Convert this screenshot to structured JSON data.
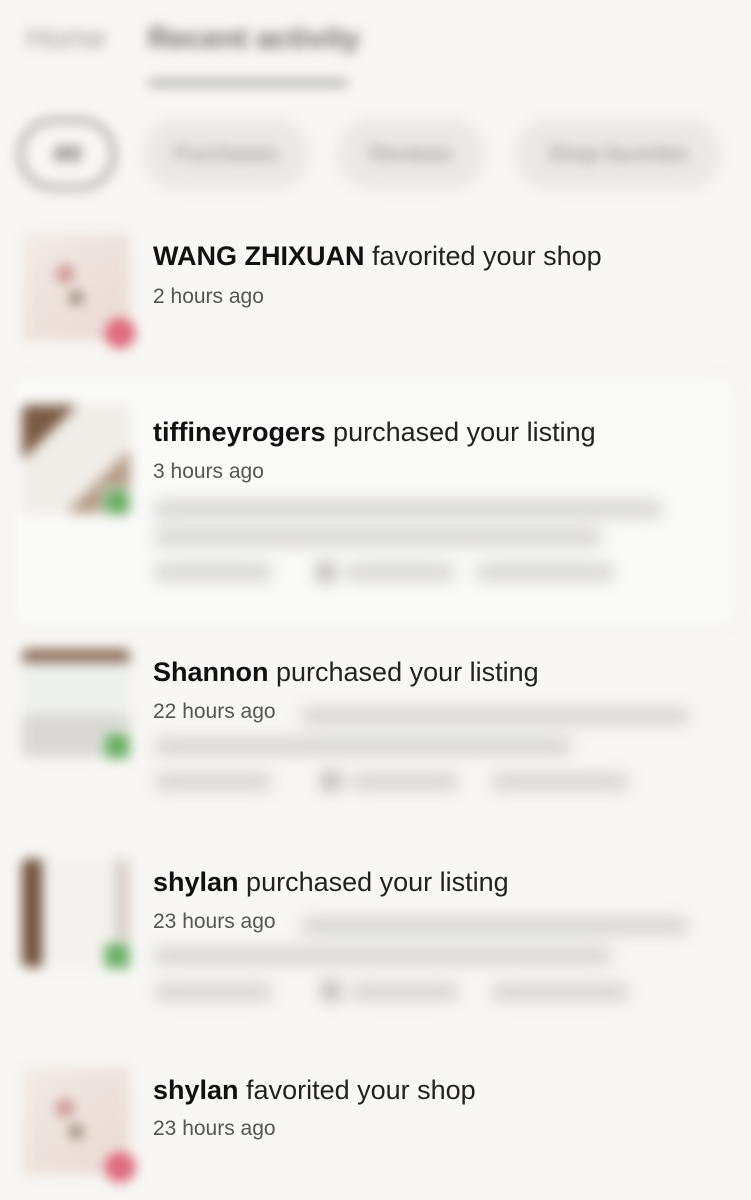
{
  "tabs": {
    "home": "Home",
    "recent": "Recent activity"
  },
  "filters": [
    "All",
    "Purchases",
    "Reviews",
    "Shop favorites"
  ],
  "activity": [
    {
      "name": "WANG ZHIXUAN",
      "action": " favorited your shop",
      "time": "2 hours ago",
      "type": "favorite"
    },
    {
      "name": "tiffineyrogers",
      "action": " purchased your listing",
      "time": "3 hours ago",
      "type": "purchase"
    },
    {
      "name": "Shannon",
      "action": " purchased your listing",
      "time": "22 hours ago",
      "type": "purchase"
    },
    {
      "name": "shylan",
      "action": " purchased your listing",
      "time": "23 hours ago",
      "type": "purchase"
    },
    {
      "name": "shylan",
      "action": " favorited your shop",
      "time": "23 hours ago",
      "type": "favorite"
    }
  ],
  "colors": {
    "background": "#f8f7f4",
    "favorite_badge": "#d9546a",
    "purchase_badge": "#5fa85a"
  },
  "icons": {
    "favorite": "heart-icon",
    "purchase": "check-icon"
  }
}
